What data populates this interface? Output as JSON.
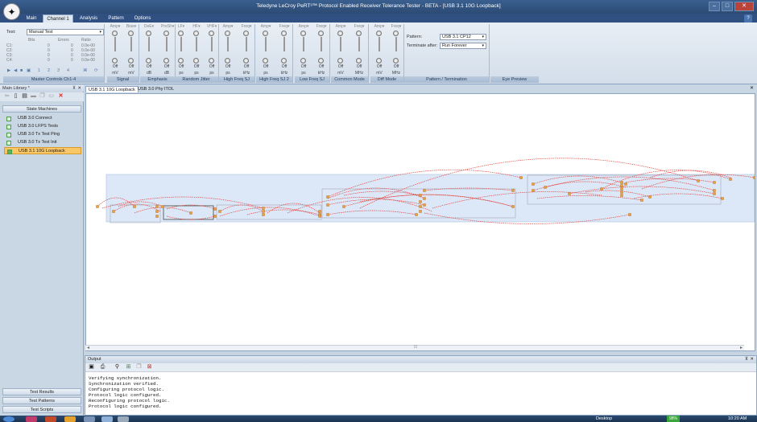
{
  "window": {
    "title": "Teledyne LeCroy PeRT³™ Protocol Enabled Receiver Tolerance Tester - BETA - [USB 3.1 10G Loopback]",
    "minimize": "–",
    "maximize": "□",
    "close": "✕"
  },
  "menu": {
    "tabs": [
      "Main",
      "Channel 1",
      "Analysis",
      "Pattern",
      "Options"
    ],
    "active": "Channel 1",
    "help": "?"
  },
  "ribbon": {
    "test_label": "Test:",
    "test_value": "Manual Test",
    "counter_headers": [
      "Bits",
      "Errors",
      "Ratio"
    ],
    "counter_rows": [
      {
        "label": "C1:",
        "bits": "0",
        "errors": "0",
        "ratio": "0.0e-00"
      },
      {
        "label": "C2:",
        "bits": "0",
        "errors": "0",
        "ratio": "0.0e-00"
      },
      {
        "label": "C3:",
        "bits": "0",
        "errors": "0",
        "ratio": "0.0e-00"
      },
      {
        "label": "C4:",
        "bits": "0",
        "errors": "0",
        "ratio": "0.0e-00"
      }
    ],
    "step_numbers": [
      "1",
      "2",
      "3",
      "4"
    ],
    "groups": [
      {
        "name": "Master Controls Ch1-4"
      },
      {
        "name": "Signal",
        "controls": [
          {
            "label": "Amp",
            "value": "Off",
            "unit": "mV"
          },
          {
            "label": "Bias",
            "value": "Off",
            "unit": "mV"
          }
        ]
      },
      {
        "name": "Emphasis",
        "controls": [
          {
            "label": "DeE",
            "value": "Off",
            "unit": "dB"
          },
          {
            "label": "PreSh",
            "value": "Off",
            "unit": "dB"
          }
        ]
      },
      {
        "name": "Random Jitter",
        "controls": [
          {
            "label": "LF",
            "value": "Off",
            "unit": "ps"
          },
          {
            "label": "HF",
            "value": "Off",
            "unit": "ps"
          },
          {
            "label": "VHF",
            "value": "Off",
            "unit": "ps"
          }
        ]
      },
      {
        "name": "High Freq SJ",
        "controls": [
          {
            "label": "Amp",
            "value": "Off",
            "unit": "ps"
          },
          {
            "label": "Freq",
            "value": "Off",
            "unit": "kHz"
          }
        ]
      },
      {
        "name": "High Freq SJ 2",
        "controls": [
          {
            "label": "Amp",
            "value": "Off",
            "unit": "ps"
          },
          {
            "label": "Freq",
            "value": "Off",
            "unit": "kHz"
          }
        ]
      },
      {
        "name": "Low Freq SJ",
        "controls": [
          {
            "label": "Amp",
            "value": "Off",
            "unit": "ps"
          },
          {
            "label": "Freq",
            "value": "Off",
            "unit": "kHz"
          }
        ]
      },
      {
        "name": "Common Mode",
        "controls": [
          {
            "label": "Amp",
            "value": "Off",
            "unit": "mV"
          },
          {
            "label": "Freq",
            "value": "Off",
            "unit": "MHz"
          }
        ]
      },
      {
        "name": "Diff Mode",
        "controls": [
          {
            "label": "Amp",
            "value": "Off",
            "unit": "mV"
          },
          {
            "label": "Freq",
            "value": "Off",
            "unit": "MHz"
          }
        ]
      }
    ],
    "pattern_label": "Pattern:",
    "pattern_value": "USB 3.1 CP12",
    "terminate_label": "Terminate after:",
    "terminate_value": "Run Forever",
    "pattern_group": "Pattern / Termination",
    "eye_group": "Eye Preview"
  },
  "left_panel": {
    "header": "Main Library *",
    "section": "State Machines",
    "items": [
      "USB 3.0 Connect",
      "USB 3.0 LFPS Tests",
      "USB 3.0 Tx Test Ping",
      "USB 3.0 Tx Test Init",
      "USB 3.1 10G Loopback"
    ],
    "selected": "USB 3.1 10G Loopback",
    "bottom_sections": [
      "Test Results",
      "Test Patterns",
      "Test Scripts"
    ]
  },
  "doc_tabs": [
    "USB 3.1 10G Loopback",
    "USB 3.0 Phy ITOL"
  ],
  "output": {
    "title": "Output",
    "lines": [
      "Verifying synchronization.",
      "Synchronization verified.",
      "Configuring protocol logic.",
      "Protocol logic configured.",
      "Reconfiguring protocol logic.",
      "Protocol logic configured."
    ]
  },
  "taskbar": {
    "desktop_label": "Desktop",
    "battery": "98%",
    "clock": "10:20 AM"
  },
  "colors": {
    "title_bg": "#2c4b74",
    "ribbon_bg": "#dfe7f1",
    "selected_item": "#f9c768",
    "diagram_line": "#e0403a",
    "diagram_band": "#dce8f7"
  }
}
